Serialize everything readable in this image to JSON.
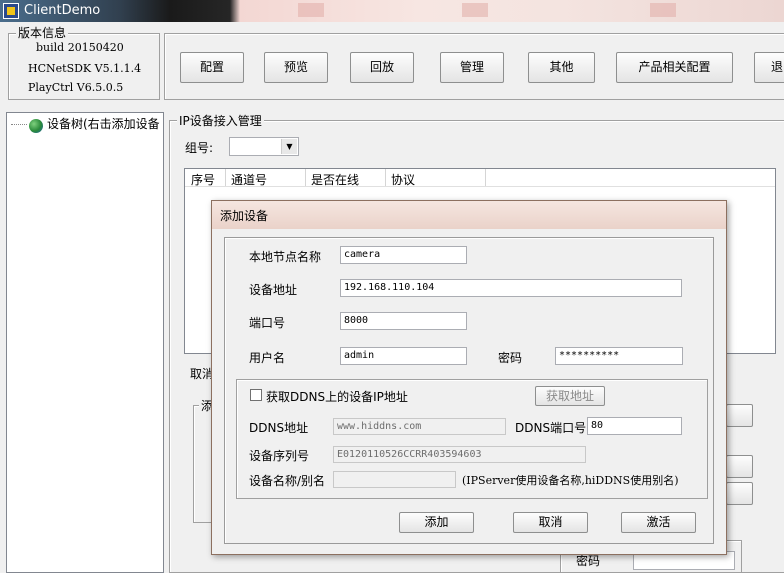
{
  "window": {
    "title": "ClientDemo"
  },
  "version_info": {
    "group_title": "版本信息",
    "build": "build 20150420",
    "sdk": "HCNetSDK V5.1.1.4",
    "playctrl": "PlayCtrl V6.5.0.5"
  },
  "toolbar": {
    "buttons": [
      "配置",
      "预览",
      "回放",
      "管理",
      "其他",
      "产品相关配置",
      "退"
    ]
  },
  "tree": {
    "root_label": "设备树(右击添加设备"
  },
  "ip_panel": {
    "group_title": "IP设备接入管理",
    "group_label": "组号:",
    "columns": [
      "序号",
      "通道号",
      "是否在线",
      "协议"
    ],
    "partial_cancel": "取消",
    "partial_add": "添",
    "partial_password": "密码"
  },
  "dialog": {
    "title": "添加设备",
    "node_name": {
      "label": "本地节点名称",
      "value": "camera"
    },
    "address": {
      "label": "设备地址",
      "value": "192.168.110.104"
    },
    "port": {
      "label": "端口号",
      "value": "8000"
    },
    "username": {
      "label": "用户名",
      "value": "admin"
    },
    "password": {
      "label": "密码",
      "value": "**********"
    },
    "ddns": {
      "checkbox_label": "获取DDNS上的设备IP地址",
      "get_button": "获取地址",
      "address_label": "DDNS地址",
      "address_value": "www.hiddns.com",
      "port_label": "DDNS端口号",
      "port_value": "80",
      "serial_label": "设备序列号",
      "serial_value": "E0120110526CCRR403594603",
      "alias_label": "设备名称/别名",
      "alias_value": "",
      "note": "(IPServer使用设备名称,hiDDNS使用别名)"
    },
    "buttons": {
      "add": "添加",
      "cancel": "取消",
      "activate": "激活"
    }
  }
}
